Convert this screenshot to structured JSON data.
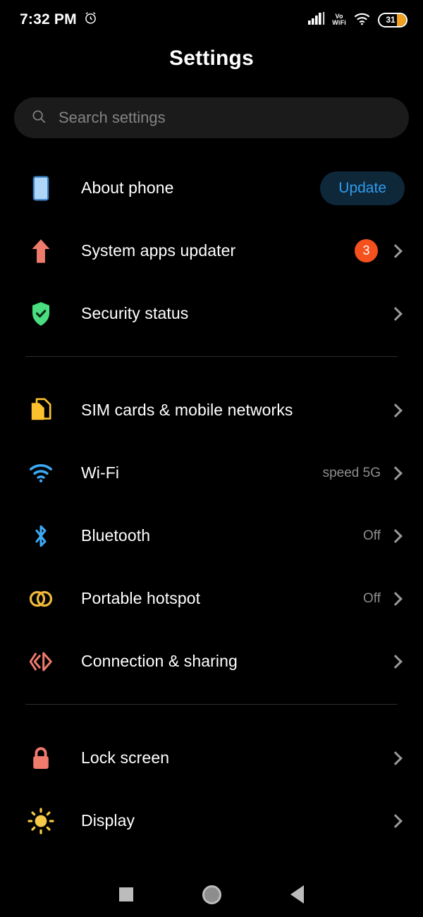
{
  "statusbar": {
    "time": "7:32 PM",
    "alarm_icon": "alarm-clock-icon",
    "signal_icon": "cellular-signal-icon",
    "volte_line1": "Vo",
    "volte_line2": "WiFi",
    "wifi_icon": "wifi-icon",
    "battery_level": "31"
  },
  "header": {
    "title": "Settings"
  },
  "search": {
    "placeholder": "Search settings",
    "icon": "search-icon"
  },
  "sections": [
    {
      "items": [
        {
          "label": "About phone",
          "icon": "phone-device-icon",
          "action": "button",
          "button_label": "Update"
        },
        {
          "label": "System apps updater",
          "icon": "up-arrow-icon",
          "badge": "3",
          "action": "chevron"
        },
        {
          "label": "Security status",
          "icon": "shield-check-icon",
          "action": "chevron"
        }
      ]
    },
    {
      "items": [
        {
          "label": "SIM cards & mobile networks",
          "icon": "sim-cards-icon",
          "action": "chevron"
        },
        {
          "label": "Wi-Fi",
          "icon": "wifi-icon",
          "value": "speed 5G",
          "action": "chevron"
        },
        {
          "label": "Bluetooth",
          "icon": "bluetooth-icon",
          "value": "Off",
          "action": "chevron"
        },
        {
          "label": "Portable hotspot",
          "icon": "hotspot-rings-icon",
          "value": "Off",
          "action": "chevron"
        },
        {
          "label": "Connection & sharing",
          "icon": "connection-sharing-icon",
          "action": "chevron"
        }
      ]
    },
    {
      "items": [
        {
          "label": "Lock screen",
          "icon": "padlock-icon",
          "action": "chevron"
        },
        {
          "label": "Display",
          "icon": "sun-brightness-icon",
          "action": "chevron"
        }
      ]
    }
  ],
  "navbar": {
    "recents": "recents-square-icon",
    "home": "home-circle-icon",
    "back": "back-triangle-icon"
  },
  "colors": {
    "background": "#000000",
    "accent_blue": "#2f9ced",
    "badge_orange": "#f4511e",
    "battery_orange": "#f0a020",
    "sim_yellow": "#fbc02d",
    "salmon": "#ef7b6d",
    "green": "#4ade80"
  }
}
